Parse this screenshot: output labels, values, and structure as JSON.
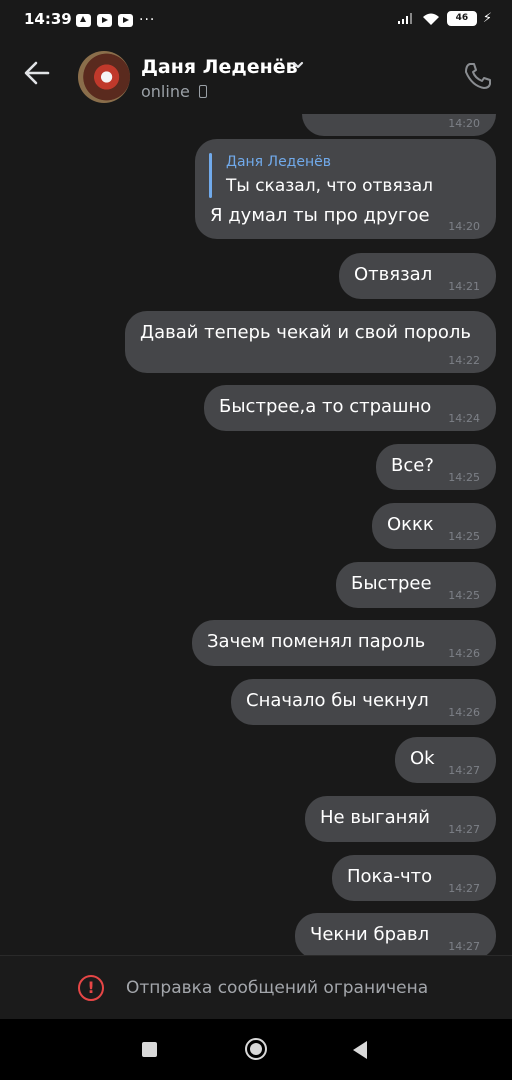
{
  "status_bar": {
    "time": "14:39",
    "battery": "46"
  },
  "header": {
    "contact_name": "Даня Леденёв",
    "status": "online"
  },
  "messages": [
    {
      "text": "",
      "time": "14:20"
    },
    {
      "reply_name": "Даня Леденёв",
      "reply_text": "Ты сказал, что отвязал",
      "text": "Я думал ты про другое",
      "time": "14:20"
    },
    {
      "text": "Отвязал",
      "time": "14:21"
    },
    {
      "text": "Давай теперь чекай и свой пороль",
      "time": "14:22"
    },
    {
      "text": "Быстрее,а то страшно",
      "time": "14:24"
    },
    {
      "text": "Все?",
      "time": "14:25"
    },
    {
      "text": "Оккк",
      "time": "14:25"
    },
    {
      "text": "Быстрее",
      "time": "14:25"
    },
    {
      "text": "Зачем поменял пароль",
      "time": "14:26"
    },
    {
      "text": "Сначало бы чекнул",
      "time": "14:26"
    },
    {
      "text": "Ok",
      "time": "14:27"
    },
    {
      "text": "Не выганяй",
      "time": "14:27"
    },
    {
      "text": "Пока-что",
      "time": "14:27"
    },
    {
      "text": "Чекни бравл",
      "time": "14:27"
    }
  ],
  "restriction": {
    "text": "Отправка сообщений ограничена"
  },
  "icons": [
    "back-arrow-icon",
    "chevron-down-icon",
    "phone-device-icon",
    "call-icon",
    "warning-icon"
  ],
  "colors": {
    "background": "#191919",
    "bubble": "#454649",
    "accent": "#71aaeb",
    "warning": "#e64646"
  }
}
